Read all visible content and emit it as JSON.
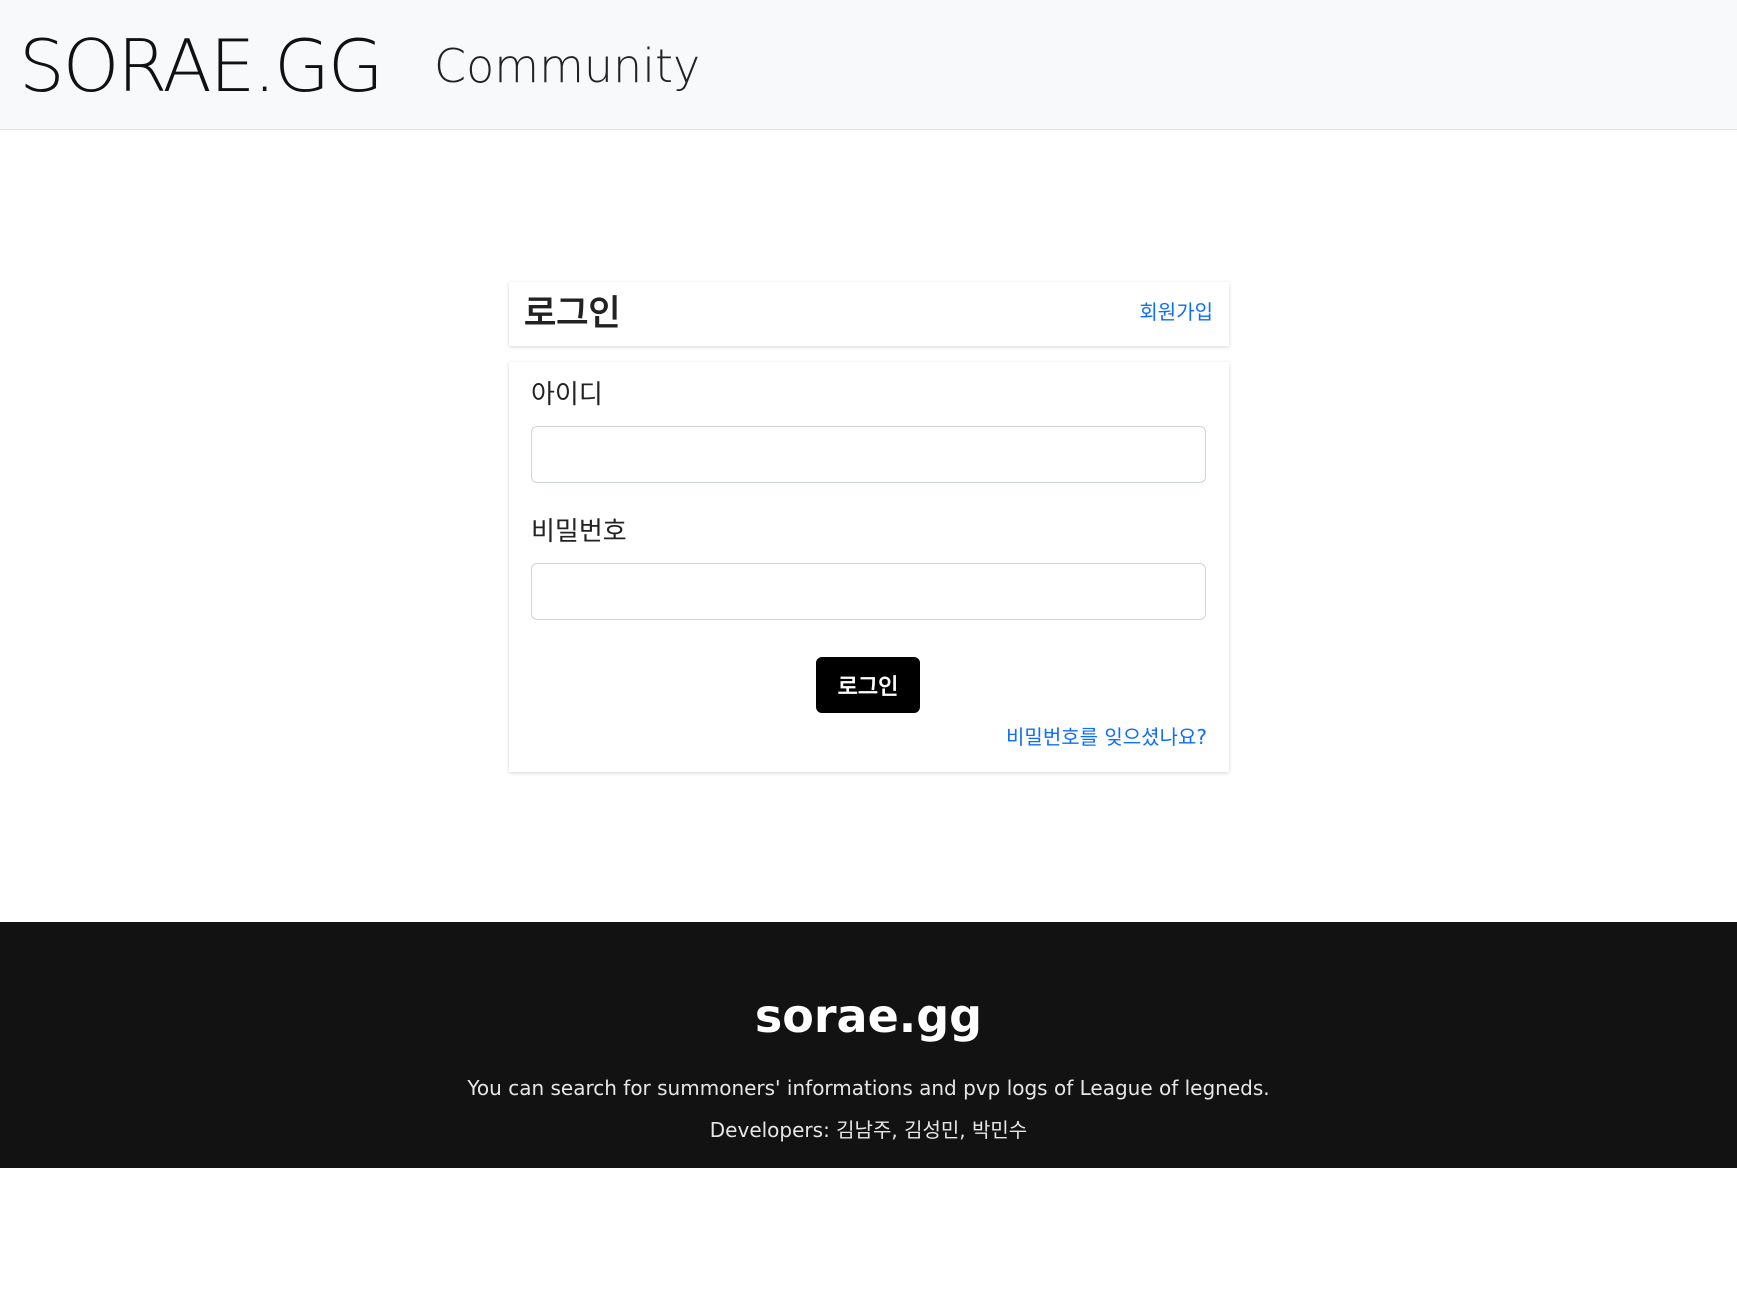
{
  "navbar": {
    "brand": "SORAE.GG",
    "links": [
      {
        "label": "Community"
      }
    ]
  },
  "login_card": {
    "title": "로그인",
    "signup_link": "회원가입",
    "id_label": "아이디",
    "id_value": "",
    "password_label": "비밀번호",
    "password_value": "",
    "submit_label": "로그인",
    "forgot_link": "비밀번호를 잊으셨나요?"
  },
  "footer": {
    "title": "sorae.gg",
    "description": "You can search for summoners' informations and pvp logs of League of legneds.",
    "developers": "Developers: 김남주, 김성민, 박민수"
  },
  "colors": {
    "link": "#0d6efd",
    "footer_bg": "#121212",
    "navbar_bg": "#f8f9fa",
    "button_bg": "#000000"
  }
}
